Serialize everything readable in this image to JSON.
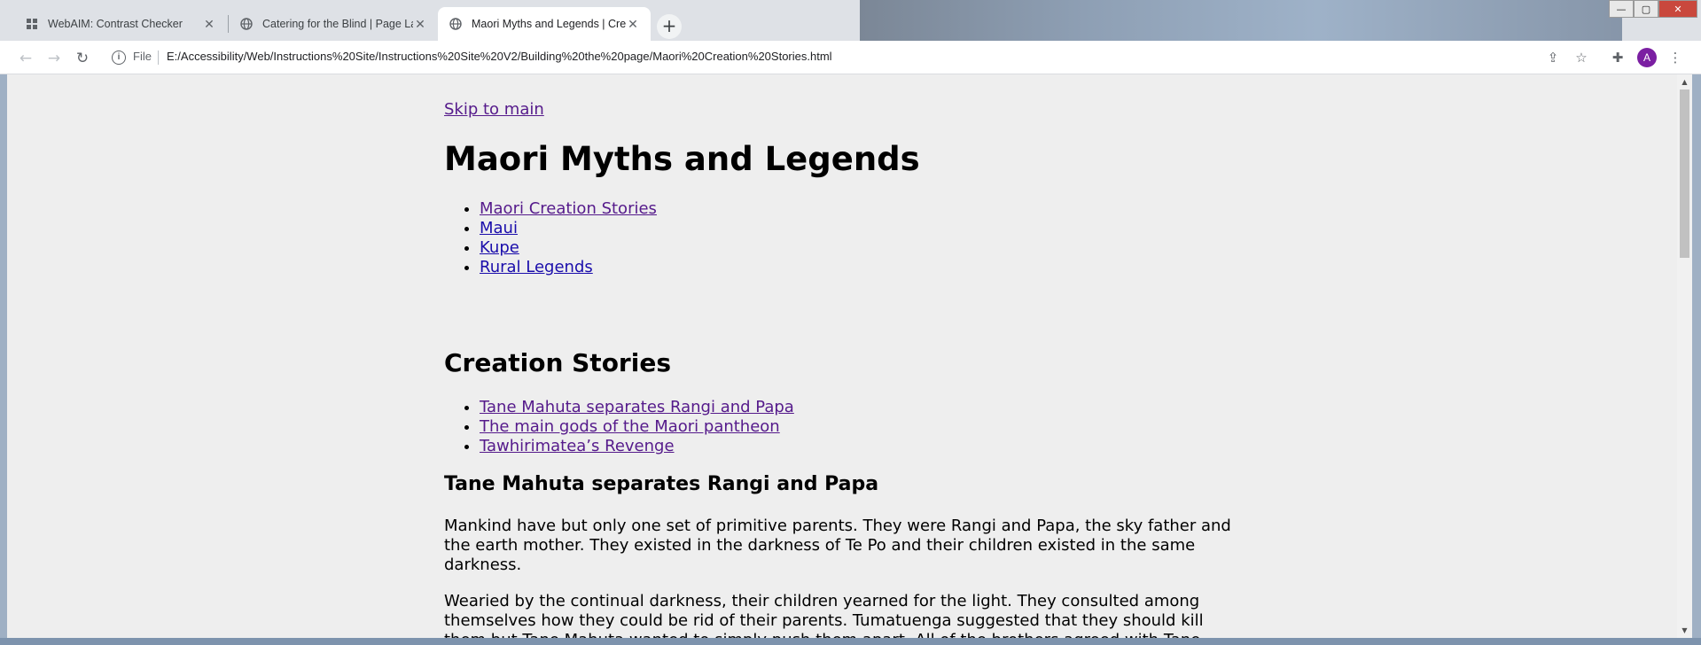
{
  "tabs": [
    {
      "title": "WebAIM: Contrast Checker",
      "icon": "grid-icon",
      "active": false
    },
    {
      "title": "Catering for the Blind | Page Layout",
      "icon": "globe-icon",
      "active": false
    },
    {
      "title": "Maori Myths and Legends | Creation Stories",
      "icon": "globe-icon",
      "active": true
    }
  ],
  "toolbar": {
    "security_chip": "File",
    "url": "E:/Accessibility/Web/Instructions%20Site/Instructions%20Site%20V2/Building%20the%20page/Maori%20Creation%20Stories.html",
    "profile_initial": "A"
  },
  "page": {
    "skip_link": "Skip to main",
    "title": "Maori Myths and Legends",
    "nav": [
      "Maori Creation Stories",
      "Maui",
      "Kupe",
      "Rural Legends"
    ],
    "section_title": "Creation Stories",
    "stories": [
      "Tane Mahuta separates Rangi and Papa",
      "The main gods of the Maori pantheon",
      "Tawhirimatea’s Revenge"
    ],
    "story_heading": "Tane Mahuta separates Rangi and Papa",
    "paragraphs": [
      "Mankind have but only one set of primitive parents. They were Rangi and Papa, the sky father and the earth mother. They existed in the darkness of Te Po and their children existed in the same darkness.",
      "Wearied by the continual darkness, their children yearned for the light. They consulted among themselves how they could be rid of their parents. Tumatuenga suggested that they should kill them but Tane Mahuta wanted to simply push them apart. All of the brothers agreed with Tane"
    ]
  },
  "colors": {
    "visited_link": "#551a8b",
    "link": "#1a0dab",
    "page_bg": "#eeeeee"
  }
}
